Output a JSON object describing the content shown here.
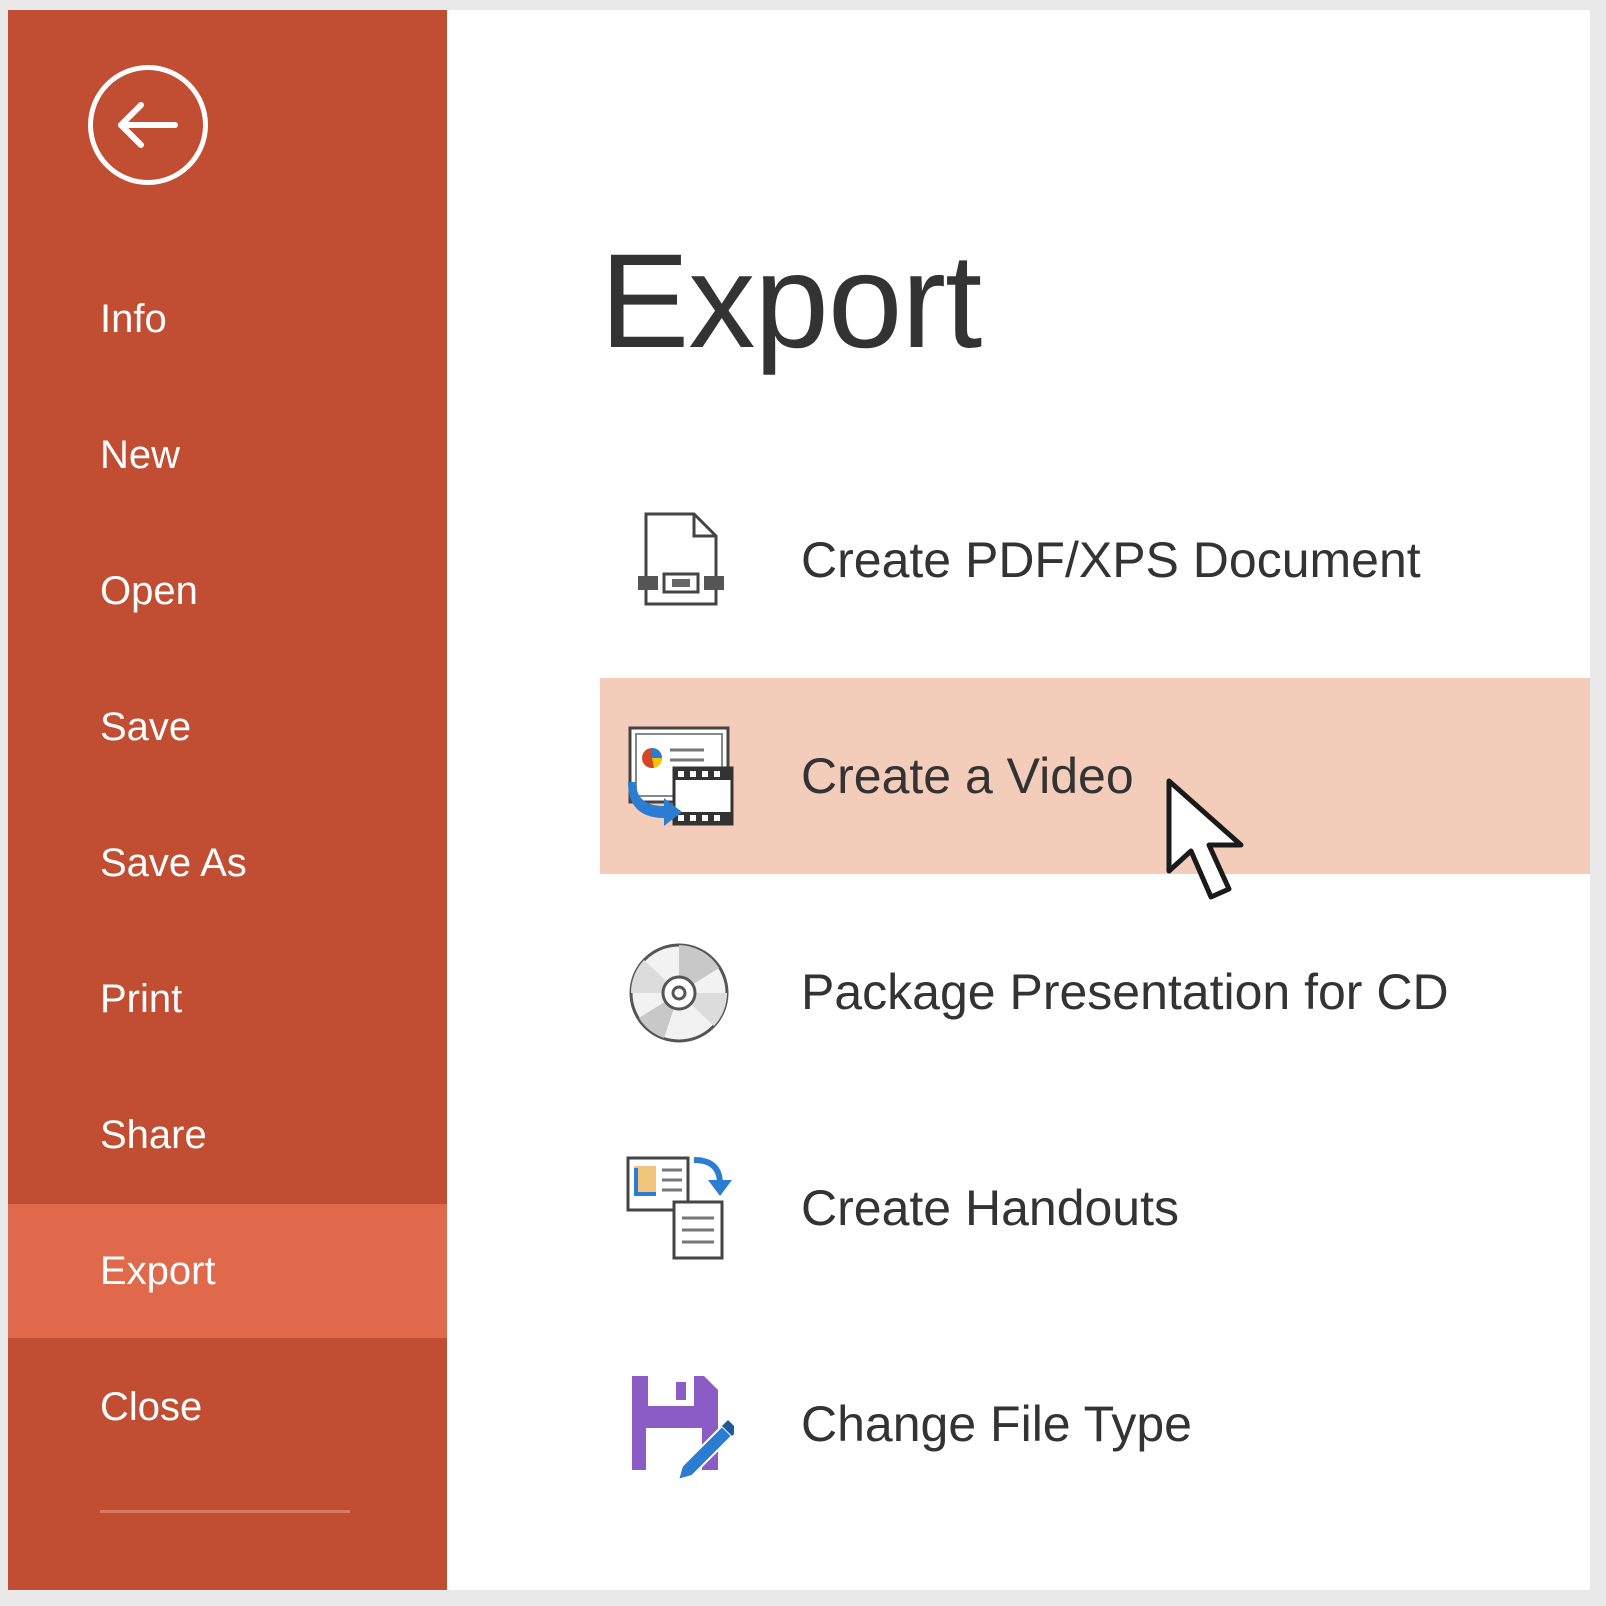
{
  "sidebar": {
    "items": [
      {
        "label": "Info"
      },
      {
        "label": "New"
      },
      {
        "label": "Open"
      },
      {
        "label": "Save"
      },
      {
        "label": "Save As"
      },
      {
        "label": "Print"
      },
      {
        "label": "Share"
      },
      {
        "label": "Export",
        "active": true
      },
      {
        "label": "Close"
      }
    ],
    "back_icon": "back-arrow-icon"
  },
  "main": {
    "title": "Export",
    "options": [
      {
        "label": "Create PDF/XPS Document",
        "icon": "pdf-document-icon"
      },
      {
        "label": "Create a Video",
        "icon": "video-icon",
        "hovered": true
      },
      {
        "label": "Package Presentation for CD",
        "icon": "cd-icon"
      },
      {
        "label": "Create Handouts",
        "icon": "handouts-icon"
      },
      {
        "label": "Change File Type",
        "icon": "save-file-type-icon"
      }
    ]
  },
  "colors": {
    "sidebar": "#c14d32",
    "sidebar_active": "#e0684b",
    "hover_row": "#f3cdb9",
    "text": "#333333"
  }
}
